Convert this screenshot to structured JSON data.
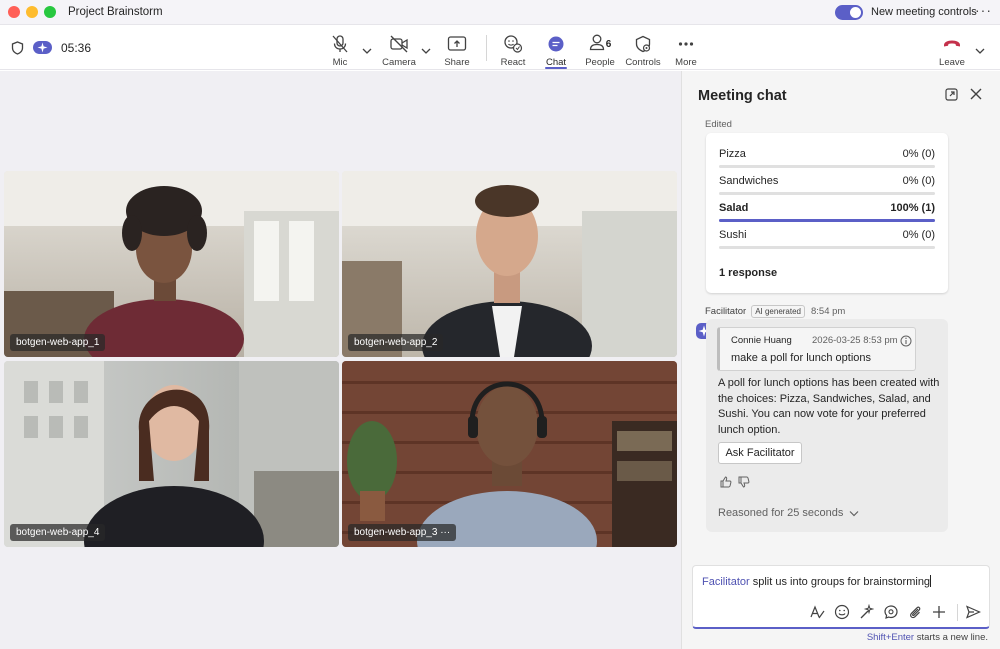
{
  "window": {
    "title": "Project Brainstorm",
    "new_controls_label": "New meeting controls",
    "new_controls_enabled": true
  },
  "toolbar": {
    "timer": "05:36",
    "mic_label": "Mic",
    "camera_label": "Camera",
    "share_label": "Share",
    "react_label": "React",
    "chat_label": "Chat",
    "people_label": "People",
    "people_count": "6",
    "controls_label": "Controls",
    "more_label": "More",
    "leave_label": "Leave",
    "accent_color": "#5b5fc7",
    "leave_color": "#c4314b"
  },
  "participants": [
    {
      "name": "botgen-web-app_1"
    },
    {
      "name": "botgen-web-app_2"
    },
    {
      "name": "botgen-web-app_4"
    },
    {
      "name": "botgen-web-app_3"
    }
  ],
  "chat": {
    "title": "Meeting chat",
    "edited_label": "Edited",
    "poll": {
      "options": [
        {
          "label": "Pizza",
          "result": "0% (0)",
          "fraction": 0
        },
        {
          "label": "Sandwiches",
          "result": "0% (0)",
          "fraction": 0
        },
        {
          "label": "Salad",
          "result": "100% (1)",
          "fraction": 1
        },
        {
          "label": "Sushi",
          "result": "0% (0)",
          "fraction": 0
        }
      ],
      "responses": "1 response"
    },
    "message": {
      "sender": "Facilitator",
      "ai_tag": "AI generated",
      "time": "8:54 pm",
      "quote_author": "Connie Huang",
      "quote_date": "2026-03-25 8:53 pm",
      "quote_text": "make a poll for lunch options",
      "body": "A poll for lunch options has been created with the choices: Pizza, Sandwiches, Salad, and Sushi. You can now vote for your preferred lunch option.",
      "action_label": "Ask Facilitator",
      "reasoned_label": "Reasoned for 25 seconds"
    },
    "compose": {
      "mention": "Facilitator",
      "text": " split us into groups for brainstorming",
      "hint_key": "Shift+Enter",
      "hint_text": " starts a new line."
    }
  }
}
